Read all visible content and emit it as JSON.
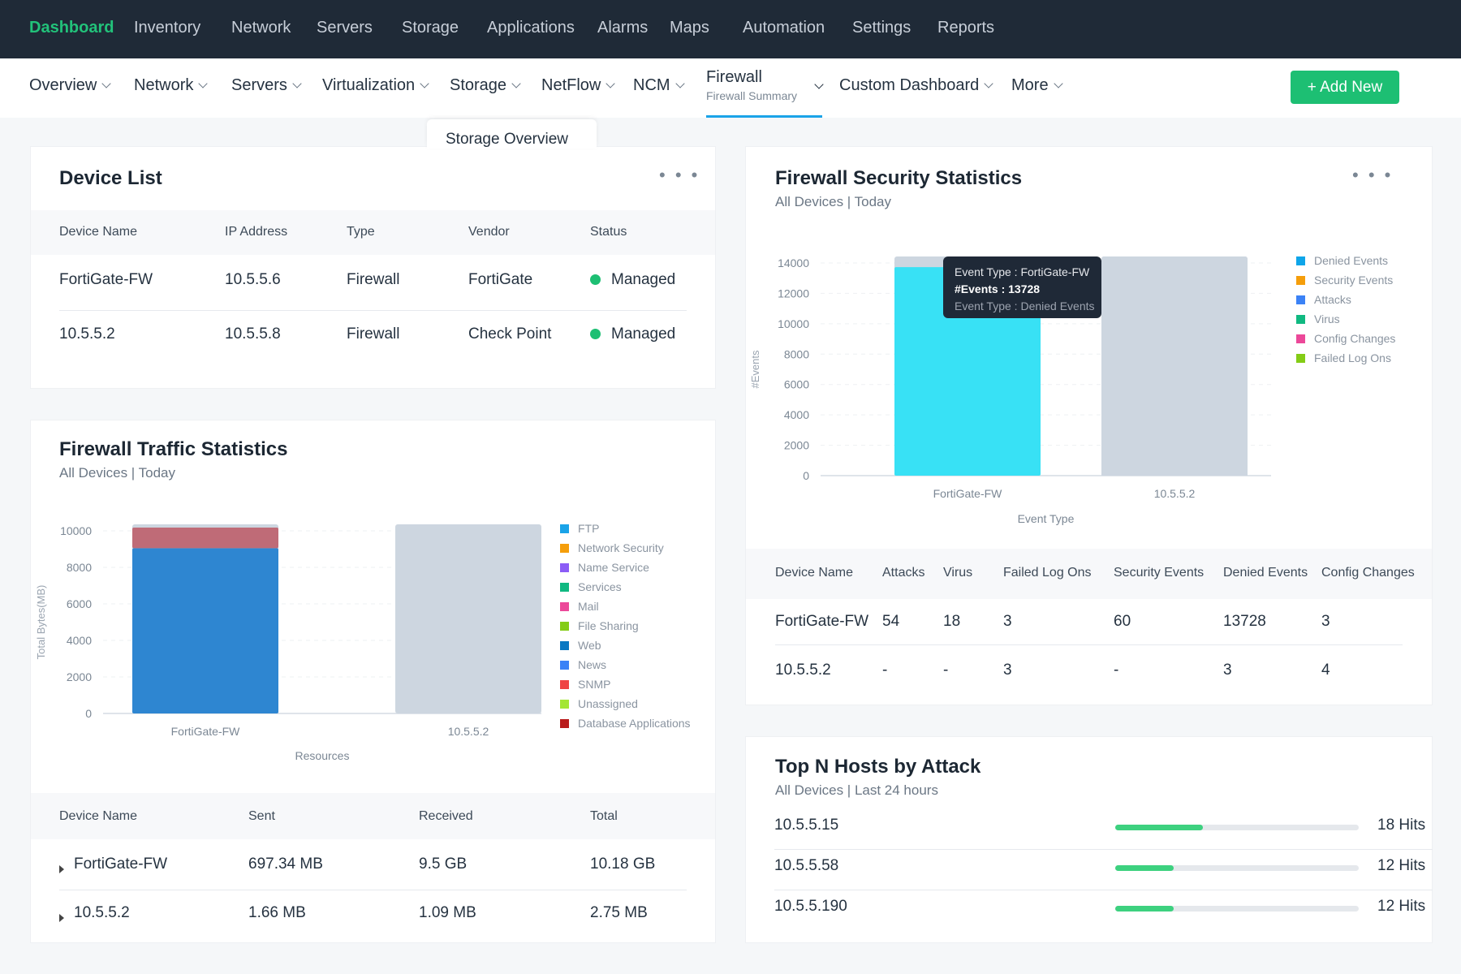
{
  "topnav": {
    "items": [
      "Dashboard",
      "Inventory",
      "Network",
      "Servers",
      "Storage",
      "Applications",
      "Alarms",
      "Maps",
      "Automation",
      "Settings",
      "Reports"
    ],
    "active": "Dashboard"
  },
  "subnav": {
    "items": [
      "Overview",
      "Network",
      "Servers",
      "Virtualization",
      "Storage",
      "NetFlow",
      "NCM",
      "Firewall",
      "Custom Dashboard",
      "More"
    ],
    "active_sub": "Firewall Summary",
    "add_new": "+ Add New",
    "dropdown_item": "Storage Overview"
  },
  "device_list": {
    "title": "Device List",
    "menu": "• • •",
    "columns": [
      "Device Name",
      "IP Address",
      "Type",
      "Vendor",
      "Status"
    ],
    "rows": [
      [
        "FortiGate-FW",
        "10.5.5.6",
        "Firewall",
        "FortiGate",
        "Managed"
      ],
      [
        "10.5.5.2",
        "10.5.5.8",
        "Firewall",
        "Check Point",
        "Managed"
      ]
    ],
    "status_color": "#1dbf73"
  },
  "traffic": {
    "title": "Firewall Traffic Statistics",
    "subtitle": "All Devices | Today",
    "columns": [
      "Device Name",
      "Sent",
      "Received",
      "Total"
    ],
    "rows": [
      [
        "FortiGate-FW",
        "697.34 MB",
        "9.5 GB",
        "10.18 GB"
      ],
      [
        "10.5.5.2",
        "1.66 MB",
        "1.09 MB",
        "2.75 MB"
      ]
    ]
  },
  "security": {
    "title": "Firewall Security Statistics",
    "subtitle": "All Devices | Today",
    "menu": "• • •",
    "tooltip": {
      "line1": "Event Type : FortiGate-FW",
      "line2": "#Events : 13728",
      "line3": "Event Type : Denied Events"
    },
    "columns": [
      "Device Name",
      "Attacks",
      "Virus",
      "Failed Log Ons",
      "Security Events",
      "Denied Events",
      "Config Changes"
    ],
    "rows": [
      [
        "FortiGate-FW",
        "54",
        "18",
        "3",
        "60",
        "13728",
        "3"
      ],
      [
        "10.5.5.2",
        "-",
        "-",
        "3",
        "-",
        "3",
        "4"
      ]
    ]
  },
  "topn": {
    "title": "Top N Hosts by Attack",
    "subtitle": "All Devices | Last 24 hours",
    "max": 50,
    "rows": [
      {
        "ip": "10.5.5.15",
        "hits": 18,
        "label": "18 Hits"
      },
      {
        "ip": "10.5.5.58",
        "hits": 12,
        "label": "12 Hits"
      },
      {
        "ip": "10.5.5.190",
        "hits": 12,
        "label": "12 Hits"
      }
    ],
    "bar_color": "#3dd17f"
  },
  "chart_data": [
    {
      "type": "bar",
      "stacked": true,
      "xlabel": "Resources",
      "ylabel": "Total Bytes(MB)",
      "ylim": [
        0,
        10000
      ],
      "yticks": [
        0,
        2000,
        4000,
        6000,
        8000,
        10000
      ],
      "grid": true,
      "legend": "right",
      "categories": [
        "FortiGate-FW",
        "10.5.5.2"
      ],
      "legend_entries": [
        {
          "name": "FTP",
          "color": "#1aa3e8"
        },
        {
          "name": "Network Security",
          "color": "#f59e0b"
        },
        {
          "name": "Name Service",
          "color": "#8b5cf6"
        },
        {
          "name": "Services",
          "color": "#10b981"
        },
        {
          "name": "Mail",
          "color": "#ec4899"
        },
        {
          "name": "File Sharing",
          "color": "#84cc16"
        },
        {
          "name": "Web",
          "color": "#0a78c2"
        },
        {
          "name": "News",
          "color": "#3b82f6"
        },
        {
          "name": "SNMP",
          "color": "#ef4444"
        },
        {
          "name": "Unassigned",
          "color": "#a3e635"
        },
        {
          "name": "Database Applications",
          "color": "#b91c1c"
        }
      ],
      "series": [
        {
          "name": "Web",
          "color": "#2e86d1",
          "values": [
            9050,
            0
          ]
        },
        {
          "name": "Database Applications",
          "color": "#bf6b77",
          "values": [
            1130,
            0
          ]
        }
      ],
      "placeholder_color": "#cdd6e0"
    },
    {
      "type": "bar",
      "stacked": true,
      "xlabel": "Event Type",
      "ylabel": "#Events",
      "ylim": [
        0,
        14000
      ],
      "yticks": [
        0,
        2000,
        4000,
        6000,
        8000,
        10000,
        12000,
        14000
      ],
      "grid": true,
      "legend": "right",
      "categories": [
        "FortiGate-FW",
        "10.5.5.2"
      ],
      "legend_entries": [
        {
          "name": "Denied Events",
          "color": "#0ea5e9"
        },
        {
          "name": "Security Events",
          "color": "#f59e0b"
        },
        {
          "name": "Attacks",
          "color": "#3b82f6"
        },
        {
          "name": "Virus",
          "color": "#10b981"
        },
        {
          "name": "Config Changes",
          "color": "#ec4899"
        },
        {
          "name": "Failed Log Ons",
          "color": "#84cc16"
        }
      ],
      "series": [
        {
          "name": "Denied Events",
          "color": "#38e1f5",
          "values": [
            13728,
            3
          ]
        }
      ],
      "placeholder_color": "#cdd6e0"
    }
  ]
}
